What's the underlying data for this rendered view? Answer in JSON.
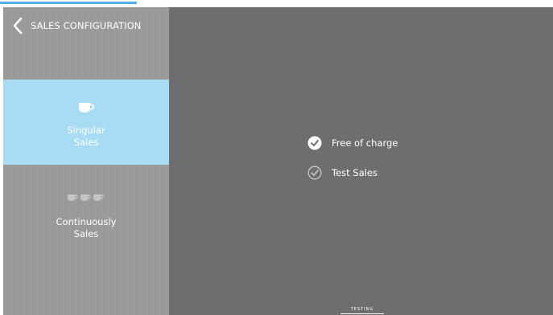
{
  "header": {
    "title": "SALES CONFIGURATION",
    "back_icon": "chevron-left-icon"
  },
  "sidebar": {
    "items": [
      {
        "label": "Singular\nSales",
        "icon": "cup-icon",
        "active": true
      },
      {
        "label": "Continuously\nSales",
        "icon": "three-cups-icon",
        "active": false
      }
    ]
  },
  "options": [
    {
      "label": "Free of charge",
      "checked": true
    },
    {
      "label": "Test Sales",
      "checked": false
    }
  ],
  "footer": {
    "badge": "TESTING"
  },
  "colors": {
    "sidebar_bg": "#9b9b9b",
    "active_item_bg": "#a8dcf5",
    "main_bg": "#6e6e70",
    "accent_top": "#2fa6e8"
  }
}
